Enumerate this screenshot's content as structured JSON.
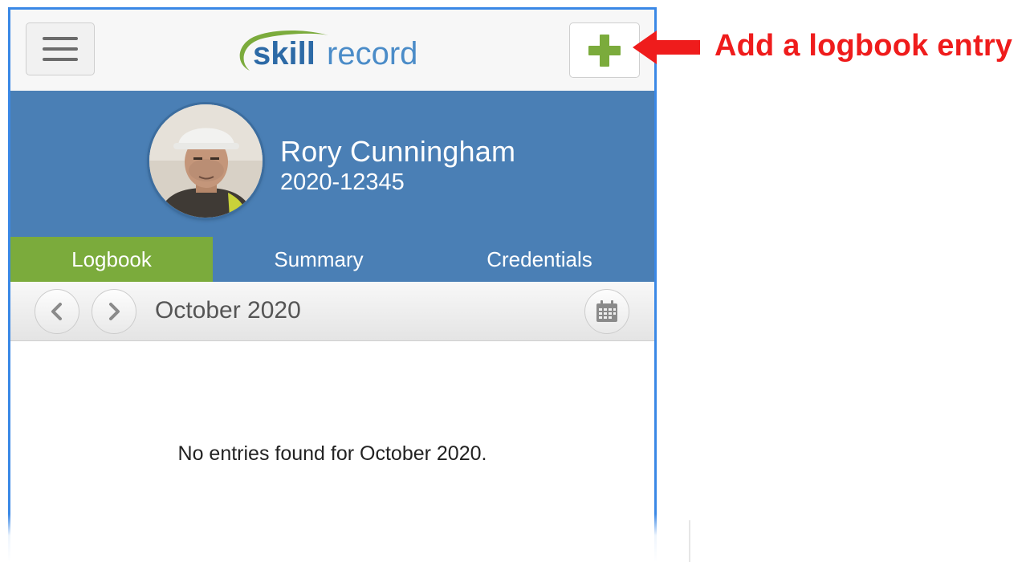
{
  "app": {
    "logo_bold": "skill",
    "logo_light": "record"
  },
  "header": {
    "menu_icon": "hamburger-menu-icon",
    "add_icon": "plus-icon"
  },
  "profile": {
    "name": "Rory Cunningham",
    "id_number": "2020-12345"
  },
  "tabs": [
    {
      "label": "Logbook",
      "active": true
    },
    {
      "label": "Summary",
      "active": false
    },
    {
      "label": "Credentials",
      "active": false
    }
  ],
  "month_nav": {
    "current_month": "October 2020",
    "prev_icon": "chevron-left-icon",
    "next_icon": "chevron-right-icon",
    "calendar_icon": "calendar-icon"
  },
  "empty_state": {
    "message": "No entries found for October 2020."
  },
  "annotation": {
    "text": "Add a logbook entry",
    "color": "#ef1c1c"
  },
  "colors": {
    "brand_blue": "#4a7fb5",
    "tab_active_green": "#7bab3c",
    "plus_green": "#7bab3c",
    "frame_blue": "#3a88e6"
  }
}
